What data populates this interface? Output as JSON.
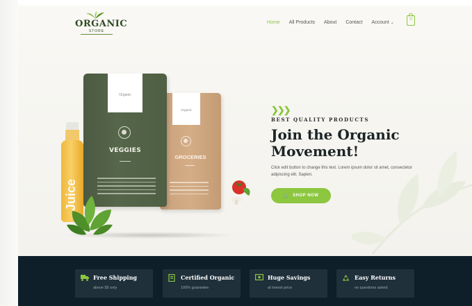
{
  "brand": {
    "logo_text": "ORGANIC",
    "logo_sub": "STORE"
  },
  "nav": {
    "items": [
      {
        "label": "Home",
        "active": true
      },
      {
        "label": "All Products",
        "active": false
      },
      {
        "label": "About",
        "active": false
      },
      {
        "label": "Contact",
        "active": false
      },
      {
        "label": "Account",
        "active": false
      }
    ],
    "account_caret": "⌄",
    "cart_count": "0"
  },
  "hero": {
    "eyebrow": "BEST QUALITY PRODUCTS",
    "headline_line1": "Join the Organic",
    "headline_line2": "Movement!",
    "description": "Click edit button to change this text. Lorem ipsum dolor sit amet, consectetur adipiscing elit. Sapien.",
    "cta_label": "SHOP NOW",
    "accent_color": "#8dc63f"
  },
  "products": {
    "bag1_title": "VEGGIES",
    "bag1_brand": "Organic",
    "bag2_title": "GROCERIES",
    "bag2_brand": "Organic",
    "bottle_word": "Juice"
  },
  "features": [
    {
      "icon": "truck-icon",
      "title": "Free Shipping",
      "subtitle": "above $5 only"
    },
    {
      "icon": "certificate-icon",
      "title": "Certified Organic",
      "subtitle": "100% guarantee"
    },
    {
      "icon": "money-icon",
      "title": "Huge Savings",
      "subtitle": "at lowest price"
    },
    {
      "icon": "recycle-icon",
      "title": "Easy Returns",
      "subtitle": "no questions asked"
    }
  ],
  "colors": {
    "footer_bar": "#0e1f2a",
    "feature_card": "#1f303b",
    "heading": "#1b2426"
  }
}
